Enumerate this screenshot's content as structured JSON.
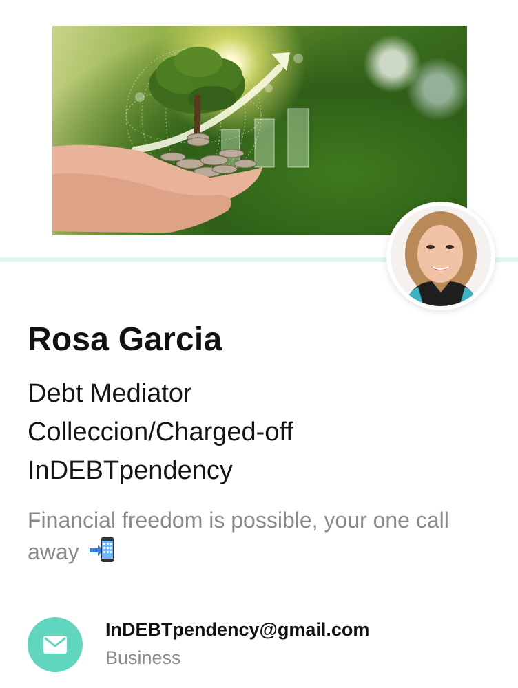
{
  "profile": {
    "name": "Rosa Garcia",
    "title_lines": [
      "Debt Mediator",
      "Colleccion/Charged-off",
      "InDEBTpendency"
    ],
    "tagline": "Financial freedom is possible, your one call away",
    "tagline_emoji": "phone-with-arrow-icon"
  },
  "contact": {
    "icon": "envelope-icon",
    "email": "InDEBTpendency@gmail.com",
    "type": "Business"
  },
  "colors": {
    "accent": "#5fd6bd",
    "divider": "#e1f3ee",
    "secondary_text": "#8a8a8a"
  }
}
